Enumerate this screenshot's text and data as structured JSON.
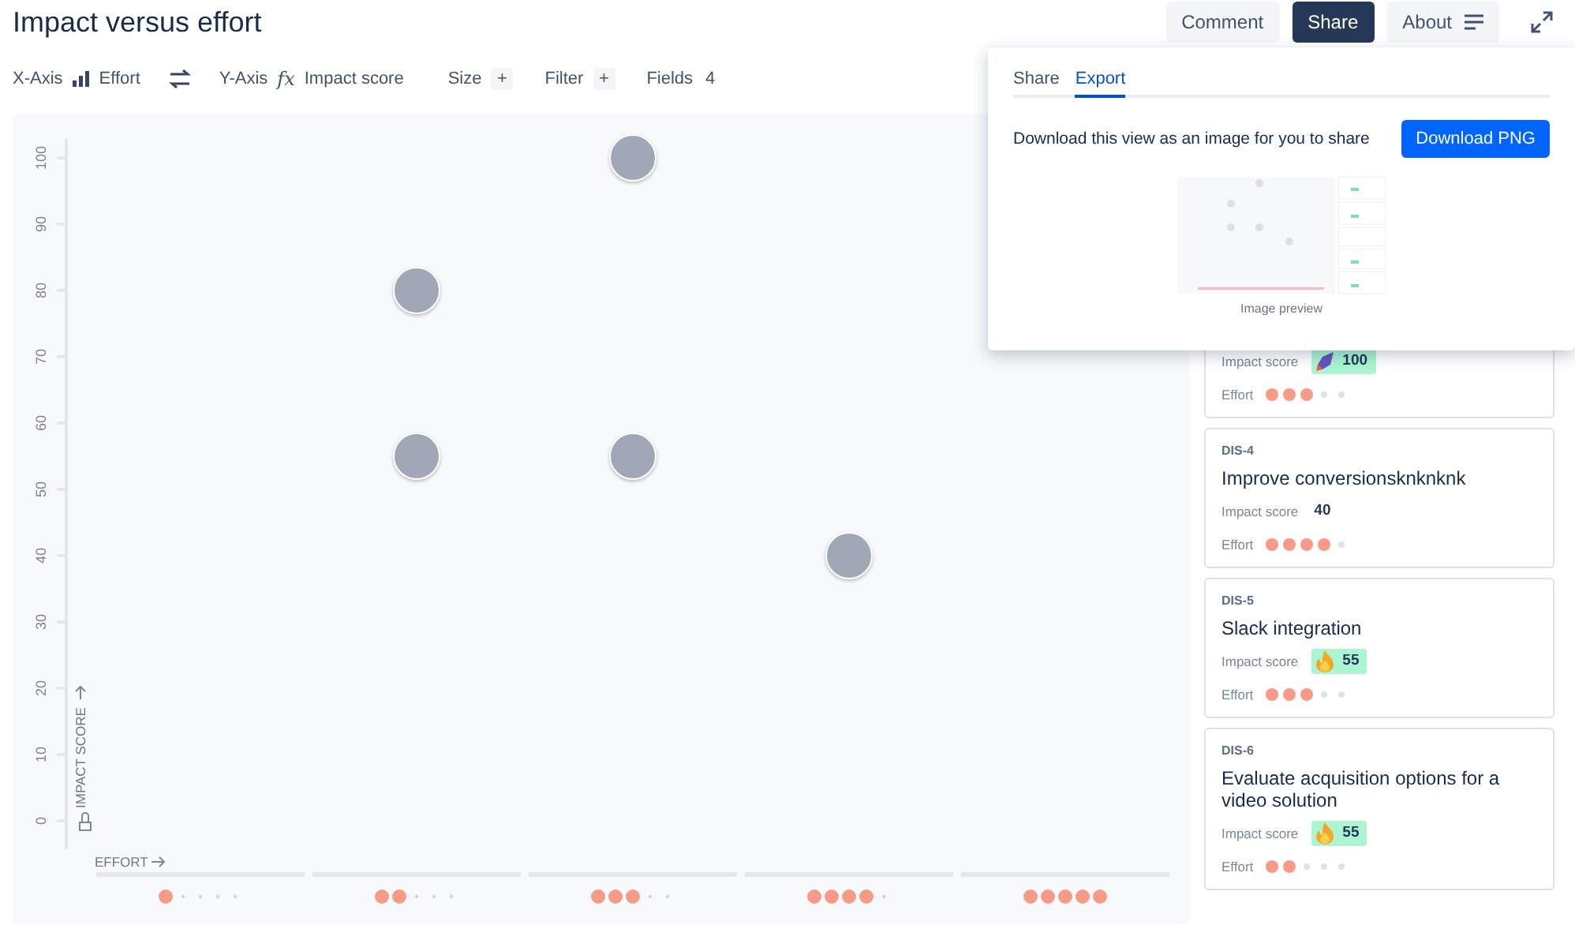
{
  "title": "Impact versus effort",
  "header_buttons": [
    {
      "label": "Comment",
      "selected": false
    },
    {
      "label": "Share",
      "selected": true
    },
    {
      "label": "About",
      "selected": false
    }
  ],
  "toolbar": {
    "x_axis_label": "X-Axis",
    "x_axis_field": "Effort",
    "y_axis_label": "Y-Axis",
    "y_axis_fx": "fx",
    "y_axis_field": "Impact score",
    "size_label": "Size",
    "size_add": "+",
    "filter_label": "Filter",
    "filter_add": "+",
    "fields_label": "Fields",
    "fields_count": "4"
  },
  "chart": {
    "x_title": "EFFORT",
    "y_title": "IMPACT SCORE",
    "y_ticks": [
      "0",
      "10",
      "20",
      "30",
      "40",
      "50",
      "60",
      "70",
      "80",
      "90",
      "100"
    ]
  },
  "cards": [
    {
      "impact": {
        "label": "Impact score",
        "value": "100",
        "kind": "rocket"
      },
      "effort_label": "Effort",
      "stars": 3
    },
    {
      "key": "DIS-4",
      "title": "Improve conversionsknknknk",
      "impact": {
        "label": "Impact score",
        "value": "40",
        "kind": "plain"
      },
      "effort_label": "Effort",
      "stars": 4
    },
    {
      "key": "DIS-5",
      "title": "Slack integration",
      "impact": {
        "label": "Impact score",
        "value": "55",
        "kind": "flame"
      },
      "effort_label": "Effort",
      "stars": 3
    },
    {
      "key": "DIS-6",
      "title": "Evaluate acquisition options for a video solution",
      "impact": {
        "label": "Impact score",
        "value": "55",
        "kind": "flame"
      },
      "effort_label": "Effort",
      "stars": 2
    }
  ],
  "popover": {
    "tabs": [
      {
        "label": "Share",
        "selected": false
      },
      {
        "label": "Export",
        "selected": true
      }
    ],
    "message": "Download this view as an image for you to share",
    "button": "Download PNG",
    "preview_caption": "Image preview"
  }
}
